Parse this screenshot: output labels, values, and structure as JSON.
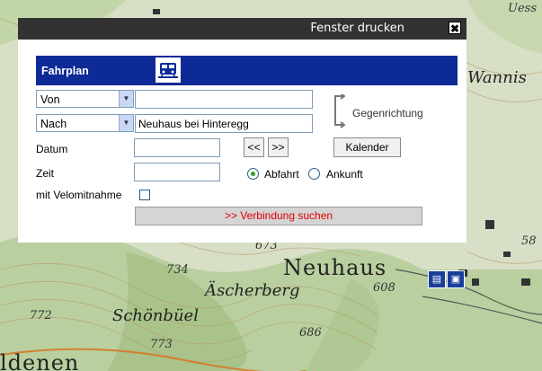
{
  "window": {
    "title": "Fenster drucken",
    "close_glyph": "✖"
  },
  "panel": {
    "title": "Fahrplan",
    "icon": "train-icon"
  },
  "from": {
    "type": "Von",
    "value": ""
  },
  "to": {
    "type": "Nach",
    "value": "Neuhaus bei Hinteregg"
  },
  "reverse_label": "Gegenrichtung",
  "date": {
    "label": "Datum",
    "value": "",
    "prev": "<<",
    "next": ">>"
  },
  "calendar_button": "Kalender",
  "time": {
    "label": "Zeit",
    "value": ""
  },
  "mode": {
    "departure_label": "Abfahrt",
    "arrival_label": "Ankunft",
    "selected": "Abfahrt"
  },
  "bike_label": "mit Velomitnahme",
  "bike_checked": false,
  "search_button": ">> Verbindung suchen",
  "map_labels": {
    "neuhaus": "Neuhaus",
    "wanni": "Wannis",
    "uessi": "Uess",
    "ascherberg": "Äscherberg",
    "schonbuel": "Schönbüel",
    "ldenen": "ldenen",
    "h734": "734",
    "h773": "773",
    "h772": "772",
    "h686": "686",
    "h608": "608",
    "h673": "673",
    "h58": "58"
  }
}
